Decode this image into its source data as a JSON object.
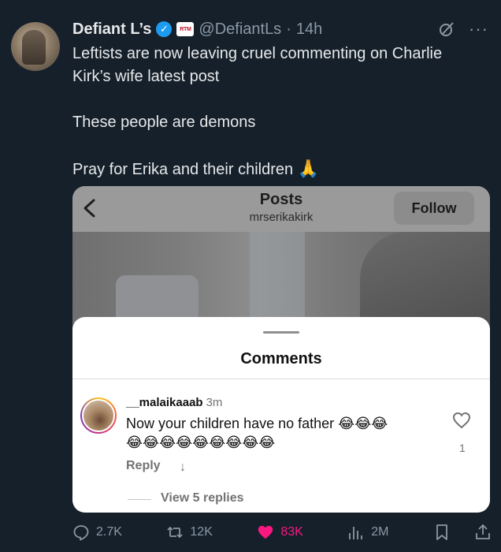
{
  "tweet": {
    "author_name": "Defiant L’s",
    "affiliation_badge": "RTM",
    "handle": "@DefiantLs",
    "separator": "·",
    "time": "14h",
    "text_lines": [
      "Leftists are now leaving cruel commenting on Charlie Kirk’s wife latest post",
      "These people are demons",
      "Pray for Erika and their children"
    ],
    "emoji": "🙏"
  },
  "embedded": {
    "title": "Posts",
    "subtitle": "mrserikakirk",
    "follow_label": "Follow",
    "sheet_title": "Comments",
    "comment": {
      "username": "__malaikaaab",
      "time": "3m",
      "text": "Now your children have no father",
      "emoji_line1": "😂😂😂",
      "emoji_line2": "😂😂😂😂😂😂😂😂😂",
      "reply_label": "Reply",
      "like_count": "1"
    },
    "view_replies": "View 5 replies"
  },
  "actions": {
    "replies": "2.7K",
    "reposts": "12K",
    "likes": "83K",
    "views": "2M"
  },
  "colors": {
    "background": "#15202b",
    "verified": "#1d9bf0",
    "like": "#f91880",
    "muted": "#8b98a5"
  }
}
